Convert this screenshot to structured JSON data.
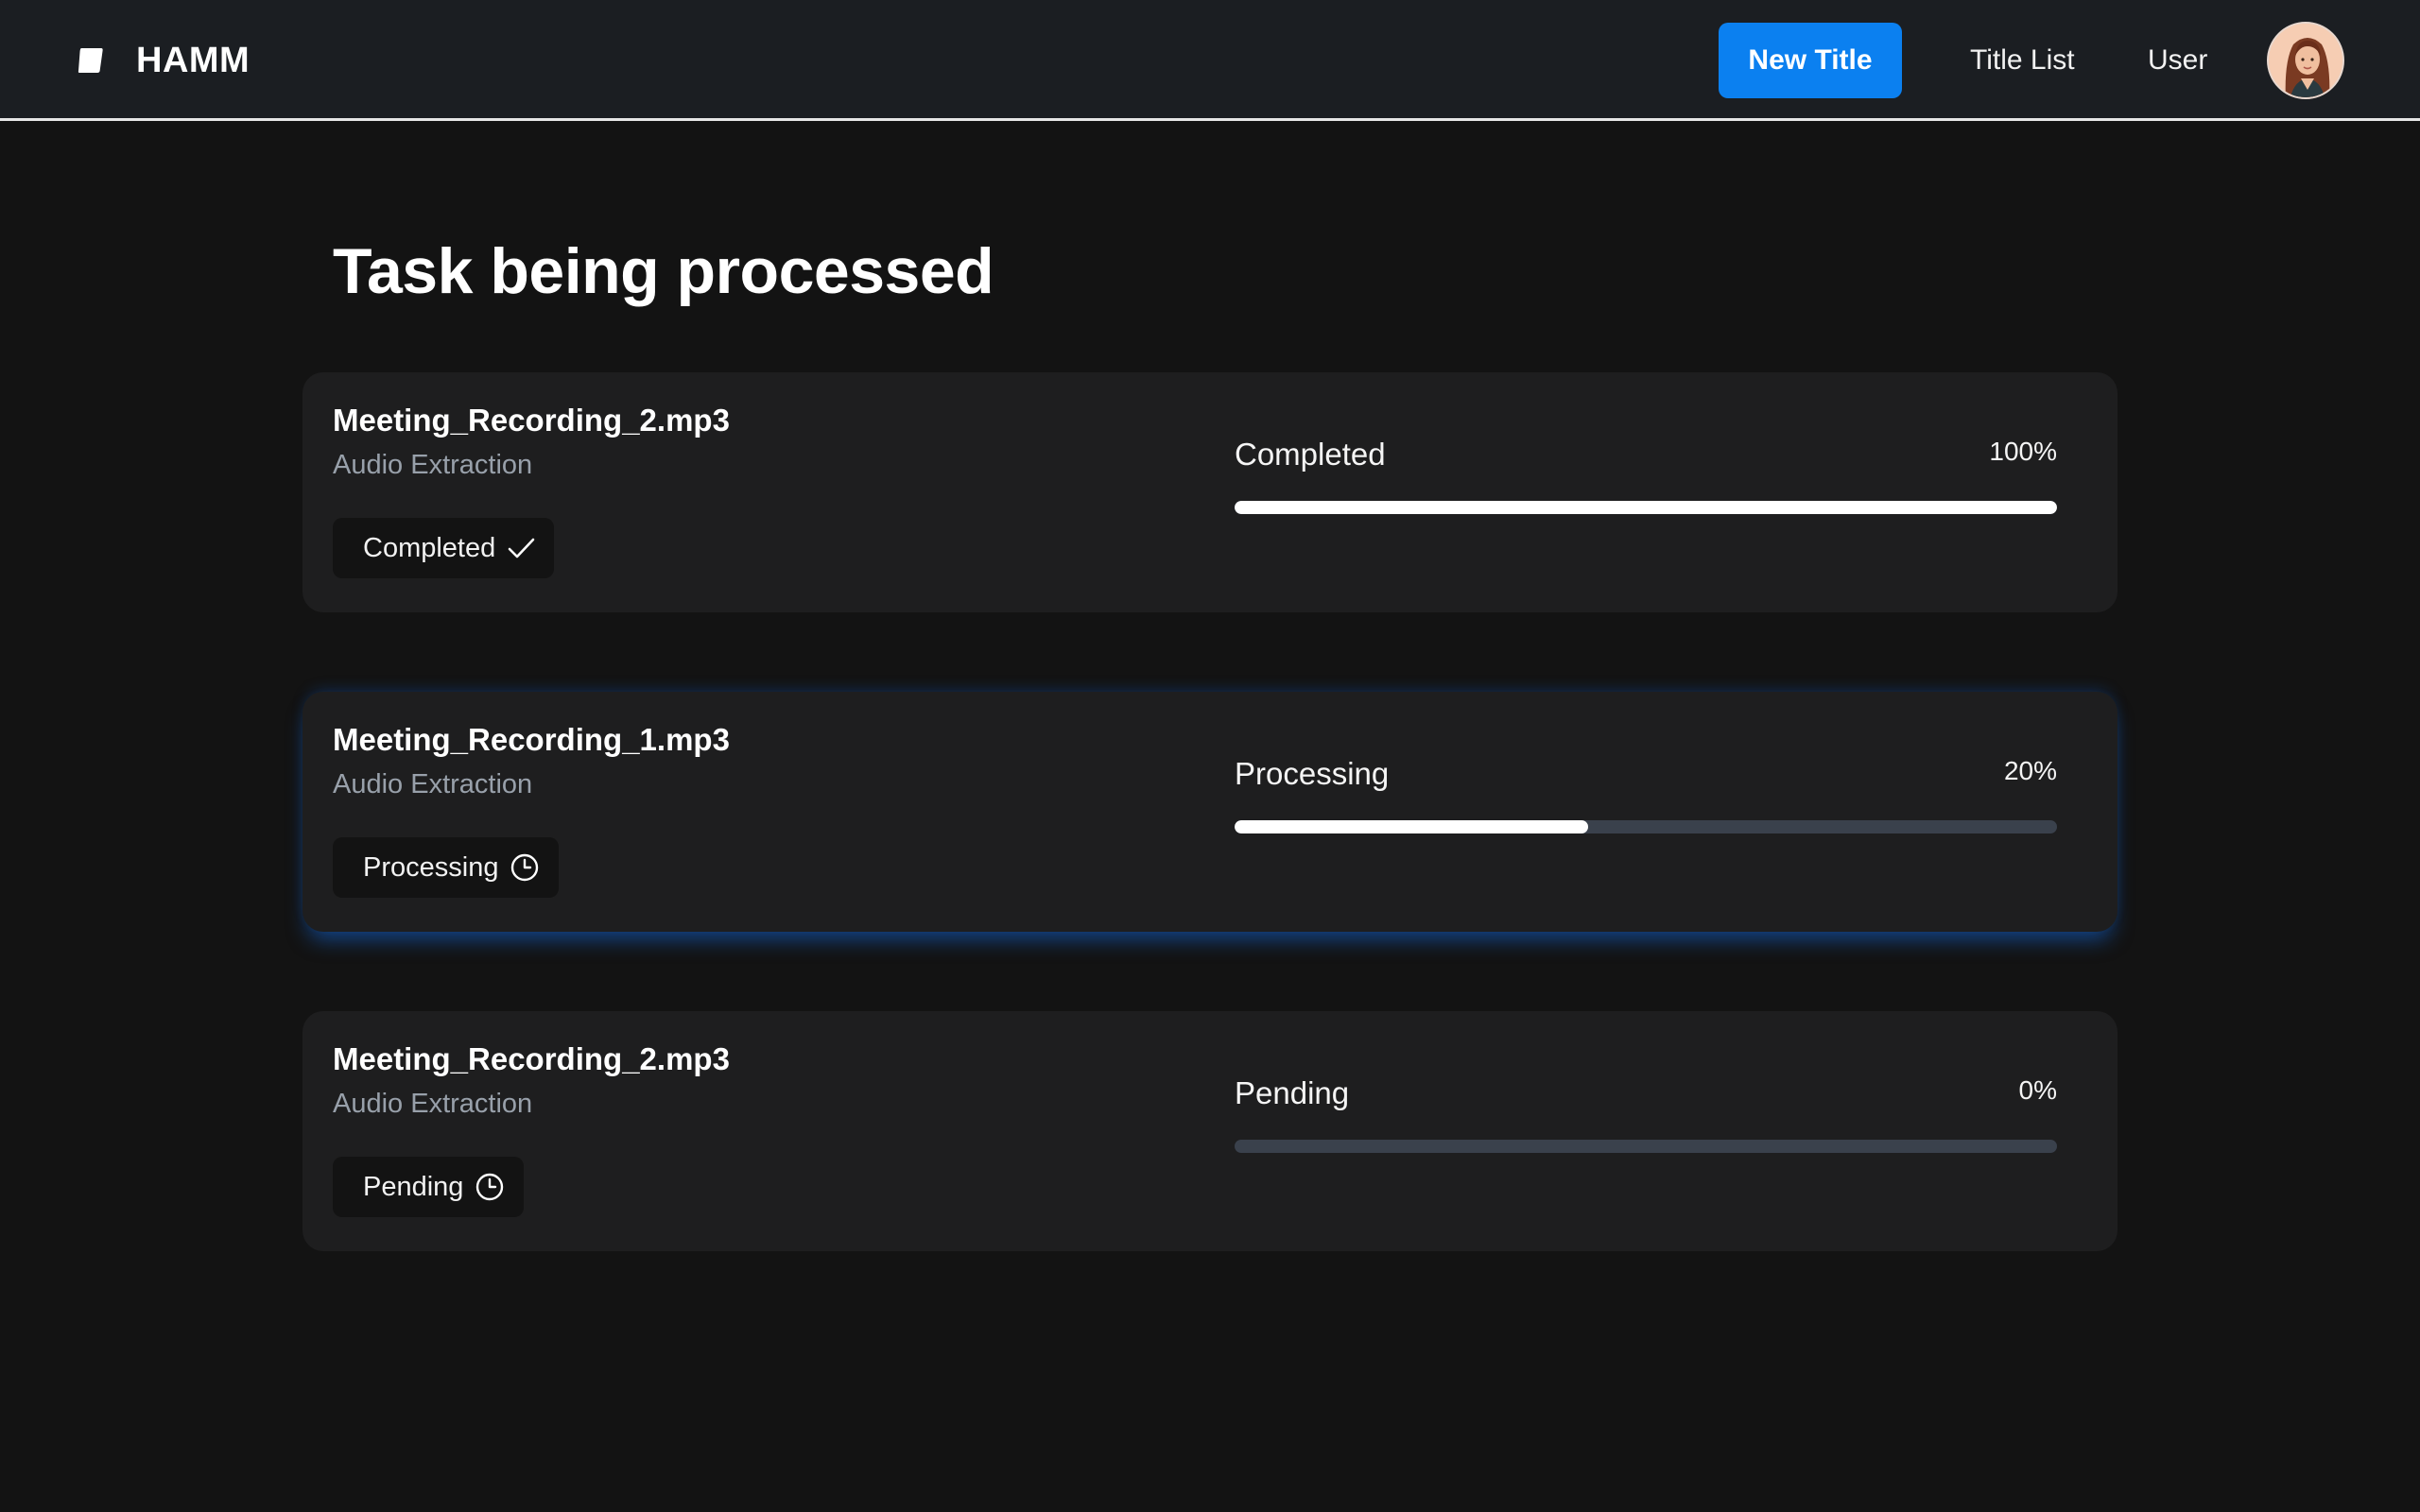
{
  "header": {
    "brand": "HAMM",
    "new_title_label": "New Title",
    "nav": {
      "title_list": "Title List",
      "user": "User"
    },
    "brand_icon": "logo-icon",
    "avatar_icon": "avatar"
  },
  "colors": {
    "accent": "#0b80f0",
    "background": "#131313",
    "card": "#1e1e1f",
    "track": "#3a414c"
  },
  "main": {
    "title": "Task being processed",
    "tasks": [
      {
        "name": "Meeting_Recording_2.mp3",
        "type": "Audio Extraction",
        "status": "Completed",
        "status_icon": "checkmark-icon",
        "progress_label": "Completed",
        "progress_text": "100%",
        "progress": 1.0,
        "active": false
      },
      {
        "name": "Meeting_Recording_1.mp3",
        "type": "Audio Extraction",
        "status": "Processing",
        "status_icon": "clock-icon",
        "progress_label": "Processing",
        "progress_text": "20%",
        "progress": 0.43,
        "active": true
      },
      {
        "name": "Meeting_Recording_2.mp3",
        "type": "Audio Extraction",
        "status": "Pending",
        "status_icon": "clock-icon",
        "progress_label": "Pending",
        "progress_text": "0%",
        "progress": 0.0,
        "active": false
      }
    ]
  }
}
